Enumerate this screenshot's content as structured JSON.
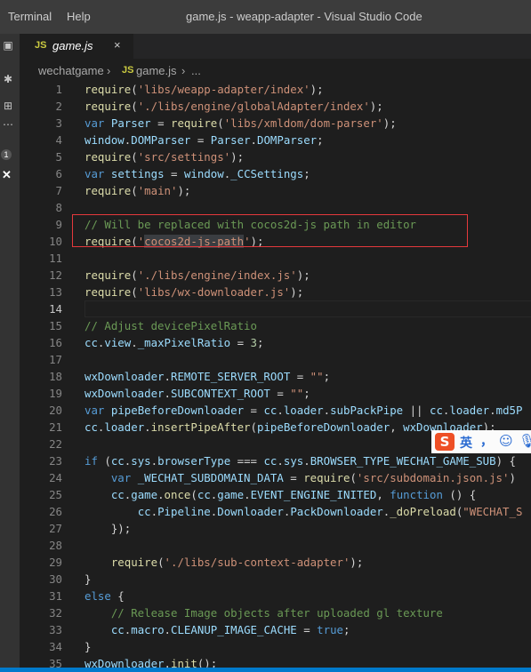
{
  "menu": [
    "Terminal",
    "Help"
  ],
  "window_title": "game.js - weapp-adapter - Visual Studio Code",
  "activity_badge": "1",
  "tab": {
    "icon": "JS",
    "name": "game.js",
    "close": "×"
  },
  "breadcrumb": {
    "folder": "wechatgame",
    "sep1": "›",
    "icon": "JS",
    "file": "game.js",
    "sep2": "›",
    "more": "..."
  },
  "ime": {
    "logo": "S",
    "lang": "英",
    "punct": "，",
    "emoji": "☺",
    "mic": "🎙"
  },
  "code_lines": [
    {
      "n": "1",
      "tokens": [
        [
          "f",
          "require"
        ],
        [
          "p",
          "("
        ],
        [
          "s",
          "'libs/weapp-adapter/index'"
        ],
        [
          "p",
          ");"
        ]
      ]
    },
    {
      "n": "2",
      "tokens": [
        [
          "f",
          "require"
        ],
        [
          "p",
          "("
        ],
        [
          "s",
          "'./libs/engine/globalAdapter/index'"
        ],
        [
          "p",
          ");"
        ]
      ]
    },
    {
      "n": "3",
      "tokens": [
        [
          "k",
          "var"
        ],
        [
          "p",
          " "
        ],
        [
          "v",
          "Parser"
        ],
        [
          "p",
          " = "
        ],
        [
          "f",
          "require"
        ],
        [
          "p",
          "("
        ],
        [
          "s",
          "'libs/xmldom/dom-parser'"
        ],
        [
          "p",
          ");"
        ]
      ]
    },
    {
      "n": "4",
      "tokens": [
        [
          "v",
          "window"
        ],
        [
          "p",
          "."
        ],
        [
          "v",
          "DOMParser"
        ],
        [
          "p",
          " = "
        ],
        [
          "v",
          "Parser"
        ],
        [
          "p",
          "."
        ],
        [
          "v",
          "DOMParser"
        ],
        [
          "p",
          ";"
        ]
      ]
    },
    {
      "n": "5",
      "tokens": [
        [
          "f",
          "require"
        ],
        [
          "p",
          "("
        ],
        [
          "s",
          "'src/settings'"
        ],
        [
          "p",
          ");"
        ]
      ]
    },
    {
      "n": "6",
      "tokens": [
        [
          "k",
          "var"
        ],
        [
          "p",
          " "
        ],
        [
          "v",
          "settings"
        ],
        [
          "p",
          " = "
        ],
        [
          "v",
          "window"
        ],
        [
          "p",
          "."
        ],
        [
          "v",
          "_CCSettings"
        ],
        [
          "p",
          ";"
        ]
      ]
    },
    {
      "n": "7",
      "tokens": [
        [
          "f",
          "require"
        ],
        [
          "p",
          "("
        ],
        [
          "s",
          "'main'"
        ],
        [
          "p",
          ");"
        ]
      ]
    },
    {
      "n": "8",
      "tokens": []
    },
    {
      "n": "9",
      "tokens": [
        [
          "c",
          "// Will be replaced with cocos2d-js path in editor"
        ]
      ]
    },
    {
      "n": "10",
      "tokens": [
        [
          "f",
          "require"
        ],
        [
          "p",
          "("
        ],
        [
          "s",
          "'"
        ],
        [
          "h",
          "cocos2d-js-path"
        ],
        [
          "s",
          "'"
        ],
        [
          "p",
          ");"
        ]
      ]
    },
    {
      "n": "11",
      "tokens": []
    },
    {
      "n": "12",
      "tokens": [
        [
          "f",
          "require"
        ],
        [
          "p",
          "("
        ],
        [
          "s",
          "'./libs/engine/index.js'"
        ],
        [
          "p",
          ");"
        ]
      ]
    },
    {
      "n": "13",
      "tokens": [
        [
          "f",
          "require"
        ],
        [
          "p",
          "("
        ],
        [
          "s",
          "'libs/wx-downloader.js'"
        ],
        [
          "p",
          ");"
        ]
      ]
    },
    {
      "n": "14",
      "tokens": [],
      "active": true
    },
    {
      "n": "15",
      "tokens": [
        [
          "c",
          "// Adjust devicePixelRatio"
        ]
      ]
    },
    {
      "n": "16",
      "tokens": [
        [
          "v",
          "cc"
        ],
        [
          "p",
          "."
        ],
        [
          "v",
          "view"
        ],
        [
          "p",
          "."
        ],
        [
          "v",
          "_maxPixelRatio"
        ],
        [
          "p",
          " = "
        ],
        [
          "n",
          "3"
        ],
        [
          "p",
          ";"
        ]
      ]
    },
    {
      "n": "17",
      "tokens": []
    },
    {
      "n": "18",
      "tokens": [
        [
          "v",
          "wxDownloader"
        ],
        [
          "p",
          "."
        ],
        [
          "v",
          "REMOTE_SERVER_ROOT"
        ],
        [
          "p",
          " = "
        ],
        [
          "s",
          "\"\""
        ],
        [
          "p",
          ";"
        ]
      ]
    },
    {
      "n": "19",
      "tokens": [
        [
          "v",
          "wxDownloader"
        ],
        [
          "p",
          "."
        ],
        [
          "v",
          "SUBCONTEXT_ROOT"
        ],
        [
          "p",
          " = "
        ],
        [
          "s",
          "\"\""
        ],
        [
          "p",
          ";"
        ]
      ]
    },
    {
      "n": "20",
      "tokens": [
        [
          "k",
          "var"
        ],
        [
          "p",
          " "
        ],
        [
          "v",
          "pipeBeforeDownloader"
        ],
        [
          "p",
          " = "
        ],
        [
          "v",
          "cc"
        ],
        [
          "p",
          "."
        ],
        [
          "v",
          "loader"
        ],
        [
          "p",
          "."
        ],
        [
          "v",
          "subPackPipe"
        ],
        [
          "p",
          " || "
        ],
        [
          "v",
          "cc"
        ],
        [
          "p",
          "."
        ],
        [
          "v",
          "loader"
        ],
        [
          "p",
          "."
        ],
        [
          "v",
          "md5P"
        ]
      ]
    },
    {
      "n": "21",
      "tokens": [
        [
          "v",
          "cc"
        ],
        [
          "p",
          "."
        ],
        [
          "v",
          "loader"
        ],
        [
          "p",
          "."
        ],
        [
          "f",
          "insertPipeAfter"
        ],
        [
          "p",
          "("
        ],
        [
          "v",
          "pipeBeforeDownloader"
        ],
        [
          "p",
          ", "
        ],
        [
          "v",
          "wxDownloader"
        ],
        [
          "p",
          ");"
        ]
      ]
    },
    {
      "n": "22",
      "tokens": []
    },
    {
      "n": "23",
      "tokens": [
        [
          "k",
          "if"
        ],
        [
          "p",
          " ("
        ],
        [
          "v",
          "cc"
        ],
        [
          "p",
          "."
        ],
        [
          "v",
          "sys"
        ],
        [
          "p",
          "."
        ],
        [
          "v",
          "browserType"
        ],
        [
          "p",
          " === "
        ],
        [
          "v",
          "cc"
        ],
        [
          "p",
          "."
        ],
        [
          "v",
          "sys"
        ],
        [
          "p",
          "."
        ],
        [
          "v",
          "BROWSER_TYPE_WECHAT_GAME_SUB"
        ],
        [
          "p",
          ") {"
        ]
      ]
    },
    {
      "n": "24",
      "tokens": [
        [
          "p",
          "    "
        ],
        [
          "k",
          "var"
        ],
        [
          "p",
          " "
        ],
        [
          "v",
          "_WECHAT_SUBDOMAIN_DATA"
        ],
        [
          "p",
          " = "
        ],
        [
          "f",
          "require"
        ],
        [
          "p",
          "("
        ],
        [
          "s",
          "'src/subdomain.json.js'"
        ],
        [
          "p",
          ")"
        ]
      ]
    },
    {
      "n": "25",
      "tokens": [
        [
          "p",
          "    "
        ],
        [
          "v",
          "cc"
        ],
        [
          "p",
          "."
        ],
        [
          "v",
          "game"
        ],
        [
          "p",
          "."
        ],
        [
          "f",
          "once"
        ],
        [
          "p",
          "("
        ],
        [
          "v",
          "cc"
        ],
        [
          "p",
          "."
        ],
        [
          "v",
          "game"
        ],
        [
          "p",
          "."
        ],
        [
          "v",
          "EVENT_ENGINE_INITED"
        ],
        [
          "p",
          ", "
        ],
        [
          "k",
          "function"
        ],
        [
          "p",
          " () {"
        ]
      ]
    },
    {
      "n": "26",
      "tokens": [
        [
          "p",
          "        "
        ],
        [
          "v",
          "cc"
        ],
        [
          "p",
          "."
        ],
        [
          "v",
          "Pipeline"
        ],
        [
          "p",
          "."
        ],
        [
          "v",
          "Downloader"
        ],
        [
          "p",
          "."
        ],
        [
          "v",
          "PackDownloader"
        ],
        [
          "p",
          "."
        ],
        [
          "f",
          "_doPreload"
        ],
        [
          "p",
          "("
        ],
        [
          "s",
          "\"WECHAT_S"
        ]
      ]
    },
    {
      "n": "27",
      "tokens": [
        [
          "p",
          "    });"
        ]
      ]
    },
    {
      "n": "28",
      "tokens": []
    },
    {
      "n": "29",
      "tokens": [
        [
          "p",
          "    "
        ],
        [
          "f",
          "require"
        ],
        [
          "p",
          "("
        ],
        [
          "s",
          "'./libs/sub-context-adapter'"
        ],
        [
          "p",
          ");"
        ]
      ]
    },
    {
      "n": "30",
      "tokens": [
        [
          "p",
          "}"
        ]
      ]
    },
    {
      "n": "31",
      "tokens": [
        [
          "k",
          "else"
        ],
        [
          "p",
          " {"
        ]
      ]
    },
    {
      "n": "32",
      "tokens": [
        [
          "p",
          "    "
        ],
        [
          "c",
          "// Release Image objects after uploaded gl texture"
        ]
      ]
    },
    {
      "n": "33",
      "tokens": [
        [
          "p",
          "    "
        ],
        [
          "v",
          "cc"
        ],
        [
          "p",
          "."
        ],
        [
          "v",
          "macro"
        ],
        [
          "p",
          "."
        ],
        [
          "v",
          "CLEANUP_IMAGE_CACHE"
        ],
        [
          "p",
          " = "
        ],
        [
          "k",
          "true"
        ],
        [
          "p",
          ";"
        ]
      ]
    },
    {
      "n": "34",
      "tokens": [
        [
          "p",
          "}"
        ]
      ]
    },
    {
      "n": "35",
      "tokens": [
        [
          "v",
          "wxDownloader"
        ],
        [
          "p",
          "."
        ],
        [
          "f",
          "init"
        ],
        [
          "p",
          "();"
        ]
      ]
    }
  ]
}
